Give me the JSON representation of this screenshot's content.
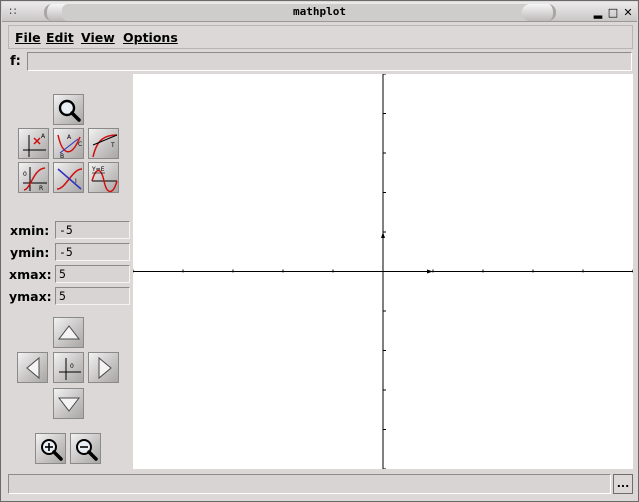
{
  "window": {
    "title": "mathplot"
  },
  "menu": {
    "file": "File",
    "edit": "Edit",
    "view": "View",
    "options": "Options"
  },
  "function_bar": {
    "label": "f:",
    "value": ""
  },
  "limits": {
    "xmin_label": "xmin:",
    "xmin": "-5",
    "ymin_label": "ymin:",
    "ymin": "-5",
    "xmax_label": "xmax:",
    "xmax": "5",
    "ymax_label": "ymax:",
    "ymax": "5"
  },
  "status": {
    "text": "",
    "more_label": "..."
  },
  "icons": {
    "zoom_tool": "magnifier-icon",
    "eval_tool": "evaluate-point-icon",
    "tangent_tool": "tangent-icon",
    "root_tool": "root-icon",
    "intersect_tool": "intersection-icon",
    "extrema_tool": "extrema-icon",
    "pan_up": "arrow-up-icon",
    "pan_left": "arrow-left-icon",
    "pan_right": "arrow-right-icon",
    "pan_down": "arrow-down-icon",
    "reset_origin": "origin-icon",
    "zoom_in": "zoom-in-icon",
    "zoom_out": "zoom-out-icon"
  },
  "colors": {
    "accent_red": "#d01010",
    "accent_blue": "#3030c0",
    "plot_bg": "#ffffff"
  }
}
